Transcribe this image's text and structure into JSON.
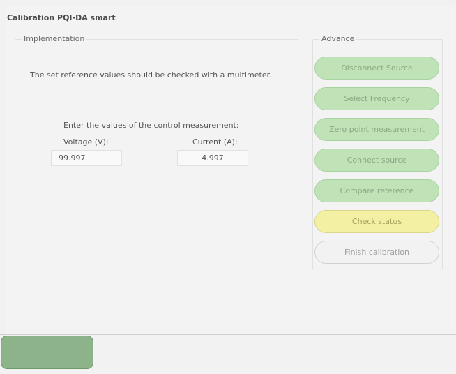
{
  "window": {
    "title": "Calibration PQI-DA smart"
  },
  "implementation": {
    "legend": "Implementation",
    "info_text": "The set reference values should be checked with a multimeter.",
    "prompt_text": "Enter the values of the control measurement:",
    "voltage": {
      "label": "Voltage (V):",
      "value": "99.997"
    },
    "current": {
      "label": "Current (A):",
      "value": "4.997"
    }
  },
  "advance": {
    "legend": "Advance",
    "steps": [
      {
        "label": "Disconnect Source",
        "state": "done"
      },
      {
        "label": "Select Frequency",
        "state": "done"
      },
      {
        "label": "Zero point measurement",
        "state": "done"
      },
      {
        "label": "Connect source",
        "state": "done"
      },
      {
        "label": "Compare reference",
        "state": "done"
      },
      {
        "label": "Check status",
        "state": "current"
      },
      {
        "label": "Finish calibration",
        "state": "pending"
      }
    ]
  },
  "bottom_bar": {
    "button_label": ""
  },
  "colors": {
    "step_done": "#bfe3b7",
    "step_current": "#f3f0a4",
    "step_pending": "#f2f2f2",
    "bottom_button": "#8cb38a"
  }
}
